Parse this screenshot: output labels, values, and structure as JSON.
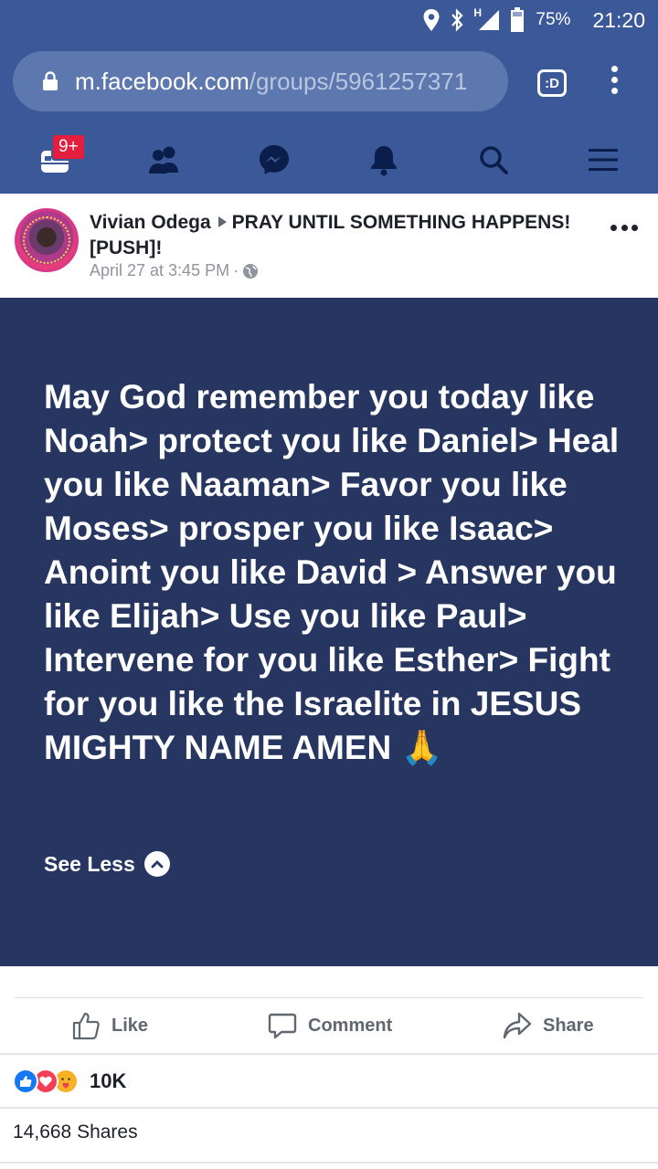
{
  "status_bar": {
    "network_label": "H",
    "battery": "75%",
    "time": "21:20"
  },
  "browser": {
    "url_domain": "m.facebook.com",
    "url_path": "/groups/5961257371",
    "tab_switcher_label": ":D"
  },
  "nav": {
    "notification_badge": "9+",
    "icons": [
      "home-icon",
      "friends-icon",
      "messenger-icon",
      "notifications-icon",
      "search-icon",
      "menu-icon"
    ]
  },
  "post": {
    "author": "Vivian Odega",
    "group": "PRAY UNTIL SOMETHING HAPPENS! [PUSH]!",
    "timestamp": "April 27 at 3:45 PM",
    "separator": "·",
    "text": "May God remember you today like Noah> protect you like Daniel> Heal you like Naaman> Favor you like Moses> prosper you like Isaac> Anoint you like David > Answer you like Elijah> Use you like Paul> Intervene for you like Esther> Fight for you like the Israelite in JESUS MIGHTY NAME AMEN",
    "emoji": "🙏",
    "see_less": "See Less",
    "background_color": "#263661"
  },
  "actions": {
    "like": "Like",
    "comment": "Comment",
    "share": "Share"
  },
  "stats": {
    "reaction_count": "10K",
    "shares": "14,668 Shares"
  },
  "colors": {
    "brand": "#3b5998",
    "badge": "#e41e3f"
  }
}
